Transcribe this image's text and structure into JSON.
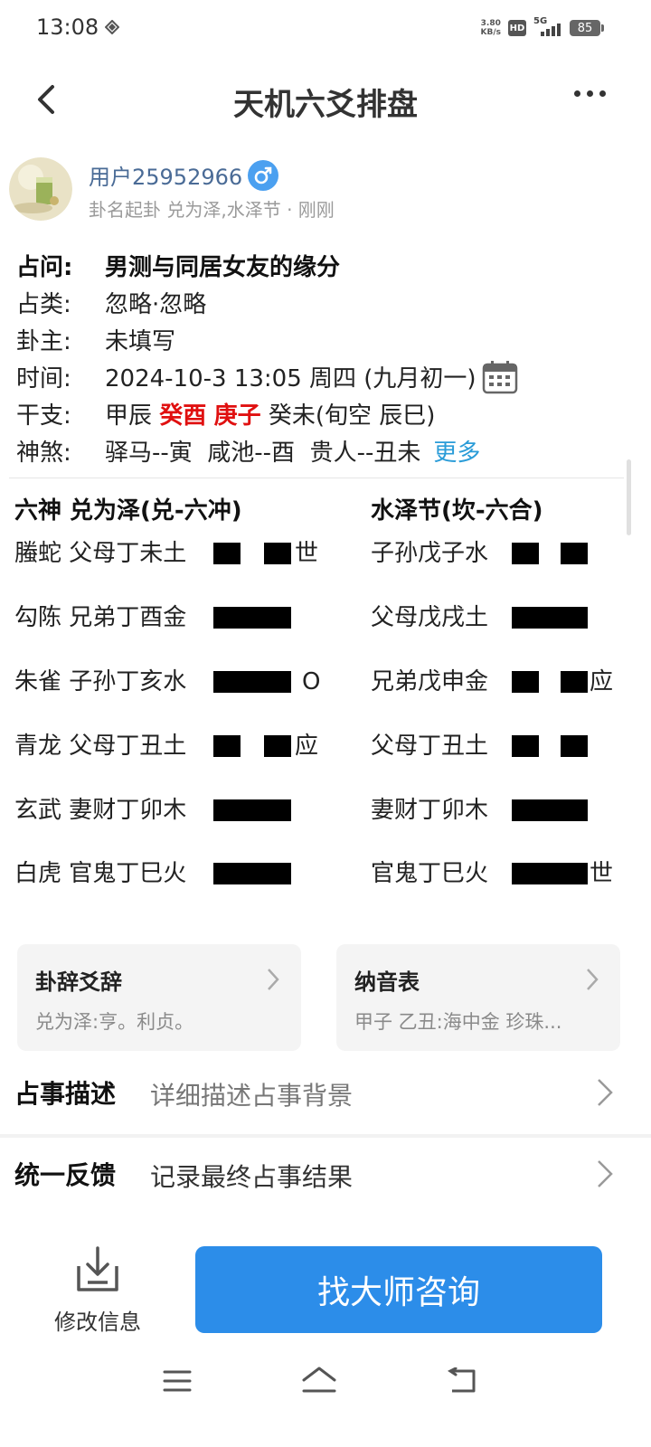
{
  "status_bar": {
    "time": "13:08",
    "net_speed_value": "3.80",
    "net_speed_unit": "KB/s",
    "hd": "HD",
    "network": "5G",
    "battery": "85"
  },
  "header": {
    "title": "天机六爻排盘"
  },
  "user": {
    "name": "用户25952966",
    "gender_icon": "male-icon",
    "subtitle": "卦名起卦 兑为泽,水泽节 · 刚刚"
  },
  "info": {
    "question_label": "占问:",
    "question": "男测与同居女友的缘分",
    "category_label": "占类:",
    "category": "忽略·忽略",
    "owner_label": "卦主:",
    "owner": "未填写",
    "time_label": "时间:",
    "time": "2024-10-3 13:05 周四 (九月初一)",
    "ganzhi_label": "干支:",
    "ganzhi_1": "甲辰",
    "ganzhi_2": "癸酉",
    "ganzhi_3": "庚子",
    "ganzhi_4": "癸未(旬空 辰巳)",
    "shensha_label": "神煞:",
    "shensha": "驿马--寅  咸池--酉  贵人--丑未",
    "shensha_more": "更多"
  },
  "hexagram": {
    "left_header": "六神 兑为泽(兑-六冲)",
    "right_header": "水泽节(坎-六合)",
    "left_rows": [
      {
        "god": "螣蛇",
        "text": "父母丁未土",
        "line": "broken",
        "mark": "世"
      },
      {
        "god": "勾陈",
        "text": "兄弟丁酉金",
        "line": "solid",
        "mark": ""
      },
      {
        "god": "朱雀",
        "text": "子孙丁亥水",
        "line": "solid",
        "mark": "O"
      },
      {
        "god": "青龙",
        "text": "父母丁丑土",
        "line": "broken",
        "mark": "应"
      },
      {
        "god": "玄武",
        "text": "妻财丁卯木",
        "line": "solid",
        "mark": ""
      },
      {
        "god": "白虎",
        "text": "官鬼丁巳火",
        "line": "solid",
        "mark": ""
      }
    ],
    "right_rows": [
      {
        "text": "子孙戊子水",
        "line": "broken",
        "mark": ""
      },
      {
        "text": "父母戊戌土",
        "line": "solid",
        "mark": ""
      },
      {
        "text": "兄弟戊申金",
        "line": "broken",
        "mark": "应"
      },
      {
        "text": "父母丁丑土",
        "line": "broken",
        "mark": ""
      },
      {
        "text": "妻财丁卯木",
        "line": "solid",
        "mark": ""
      },
      {
        "text": "官鬼丁巳火",
        "line": "solid",
        "mark": "世"
      }
    ]
  },
  "cards": {
    "gua_title": "卦辞爻辞",
    "gua_sub": "兑为泽:亨。利贞。",
    "nayin_title": "纳音表",
    "nayin_sub": "甲子 乙丑:海中金 珍珠..."
  },
  "list": {
    "desc_label": "占事描述",
    "desc_value": "详细描述占事背景",
    "feedback_label": "统一反馈",
    "feedback_value": "记录最终占事结果"
  },
  "bottom": {
    "edit_label": "修改信息",
    "consult_label": "找大师咨询"
  },
  "colors": {
    "accent": "#2c8de9",
    "highlight_red": "#e01010",
    "link_blue": "#2a9cd8",
    "user_blue": "#4a6b96"
  }
}
